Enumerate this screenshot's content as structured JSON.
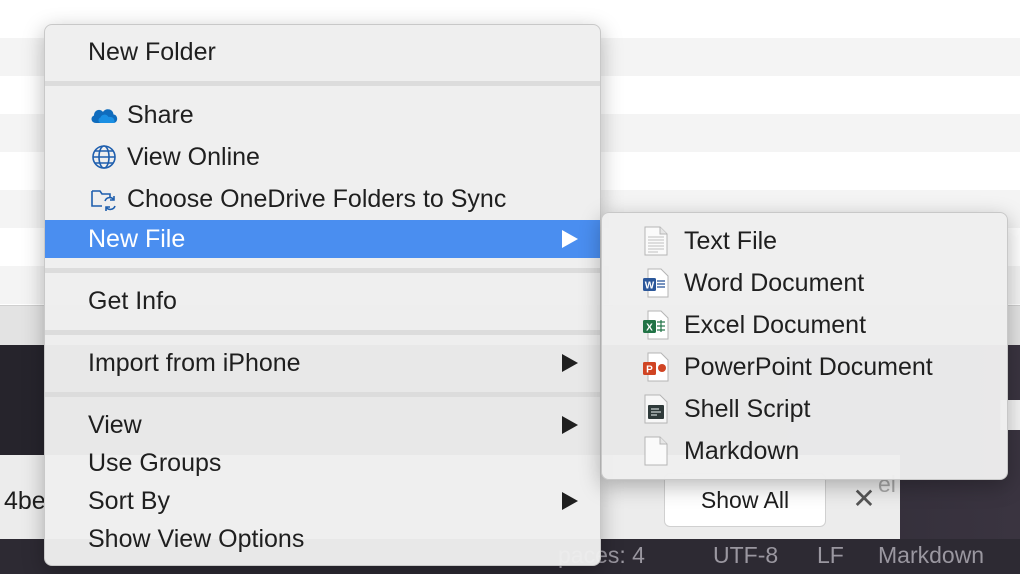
{
  "main_menu": {
    "new_folder": "New Folder",
    "share": "Share",
    "view_online": "View Online",
    "choose_sync": "Choose OneDrive Folders to Sync",
    "new_file": "New File",
    "get_info": "Get Info",
    "import_iphone": "Import from iPhone",
    "view": "View",
    "use_groups": "Use Groups",
    "sort_by": "Sort By",
    "show_view_options": "Show View Options"
  },
  "new_file_submenu": {
    "items": [
      {
        "label": "Text File",
        "icon": "text-file-icon"
      },
      {
        "label": "Word Document",
        "icon": "word-document-icon"
      },
      {
        "label": "Excel Document",
        "icon": "excel-document-icon"
      },
      {
        "label": "PowerPoint Document",
        "icon": "powerpoint-document-icon"
      },
      {
        "label": "Shell Script",
        "icon": "shell-script-icon"
      },
      {
        "label": "Markdown",
        "icon": "markdown-file-icon"
      }
    ]
  },
  "background": {
    "partial_text": "4be",
    "show_all_button": "Show All",
    "ghost_text": "el"
  },
  "status_bar": {
    "spaces": "paces: 4",
    "encoding": "UTF-8",
    "line_ending": "LF",
    "language": "Markdown"
  },
  "colors": {
    "highlight": "#4a8ef0",
    "onedrive": "#0f6cbd",
    "word": "#2b579a",
    "excel": "#217346",
    "powerpoint": "#d04423"
  }
}
